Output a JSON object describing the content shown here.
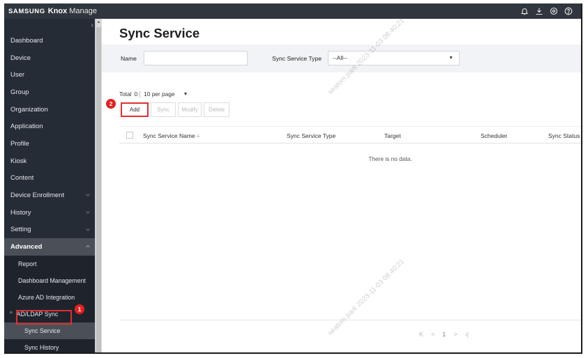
{
  "app": {
    "brand_samsung": "SAMSUNG",
    "brand_knox": "Knox",
    "brand_manage": "Manage",
    "header_icons": [
      "bell-icon",
      "download-icon",
      "settings-icon",
      "help-icon"
    ]
  },
  "sidebar": {
    "collapse_icon": "‹",
    "items": [
      {
        "label": "Dashboard"
      },
      {
        "label": "Device"
      },
      {
        "label": "User"
      },
      {
        "label": "Group"
      },
      {
        "label": "Organization"
      },
      {
        "label": "Application"
      },
      {
        "label": "Profile"
      },
      {
        "label": "Kiosk"
      },
      {
        "label": "Content"
      },
      {
        "label": "Device Enrollment",
        "chevron": "down"
      },
      {
        "label": "History",
        "chevron": "down"
      },
      {
        "label": "Setting",
        "chevron": "down"
      },
      {
        "label": "Advanced",
        "chevron": "up",
        "expanded": true
      }
    ],
    "advanced_sub": [
      {
        "label": "Report"
      },
      {
        "label": "Dashboard Management"
      },
      {
        "label": "Azure AD Integration"
      },
      {
        "label": "AD/LDAP Sync",
        "group": true
      },
      {
        "label": "Sync Service",
        "active": true
      },
      {
        "label": "Sync History"
      }
    ]
  },
  "page": {
    "title": "Sync Service"
  },
  "filters": {
    "name_label": "Name",
    "name_value": "",
    "type_label": "Sync Service Type",
    "type_selected": "--All--"
  },
  "list": {
    "total_label": "Total",
    "total_count": "0",
    "per_page": "10 per page",
    "buttons": {
      "add": "Add",
      "sync": "Sync",
      "modify": "Modify",
      "delete": "Delete"
    },
    "columns": {
      "name": "Sync Service Name",
      "type": "Sync Service Type",
      "target": "Target",
      "scheduler": "Scheduler",
      "status": "Sync Status"
    },
    "empty_message": "There is no data."
  },
  "pagination": {
    "first": "K",
    "prev": "<",
    "current": "1",
    "next": ">",
    "last": "›|"
  },
  "annotations": {
    "step1": "1",
    "step2": "2"
  },
  "watermark": "seatom.park 2023-11-03 08:40:21"
}
